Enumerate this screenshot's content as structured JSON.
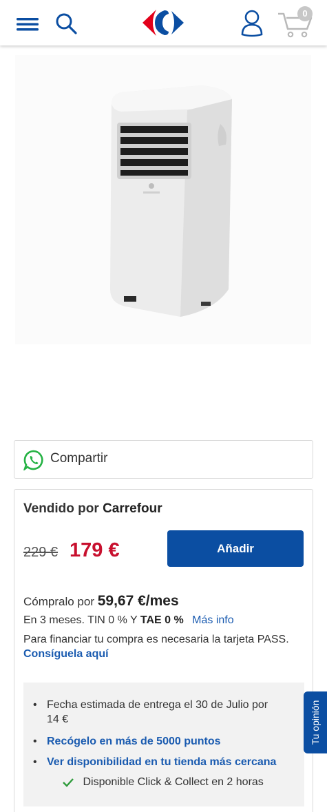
{
  "header": {
    "icons": [
      "menu-icon",
      "search-icon",
      "carrefour-logo",
      "user-icon",
      "cart-icon"
    ],
    "cart_count": "0",
    "brand_colors": {
      "blue": "#0b4ea2",
      "red": "#e2001a"
    }
  },
  "share": {
    "label": "Compartir",
    "icon": "whatsapp-icon"
  },
  "seller": {
    "sold_by_prefix": "Vendido por",
    "seller_name": "Carrefour",
    "old_price": "229 €",
    "new_price": "179 €",
    "add_button": "Añadir"
  },
  "financing": {
    "line1_prefix": "Cómpralo por",
    "monthly_amount": "59,67 €/mes",
    "line2_prefix": "En 3 meses. TIN 0 % Y",
    "tae_label": "TAE 0 %",
    "more_info": "Más info",
    "line3_text": "Para financiar tu compra es necesaria la tarjeta PASS.",
    "line3_link": "Consíguela aquí"
  },
  "delivery": {
    "estimate": "Fecha estimada de entrega el 30 de Julio por 14 €",
    "pickup_link": "Recógelo en más de 5000 puntos",
    "availability_link": "Ver disponibilidad en tu tienda más cercana",
    "click_collect": "Disponible Click & Collect en 2 horas"
  },
  "feedback_tab": "Tu opinión",
  "colors": {
    "price_red": "#c8102e",
    "button_blue": "#0b4ea2",
    "link_blue": "#1a5bb0",
    "check_green": "#2e9b3b"
  }
}
